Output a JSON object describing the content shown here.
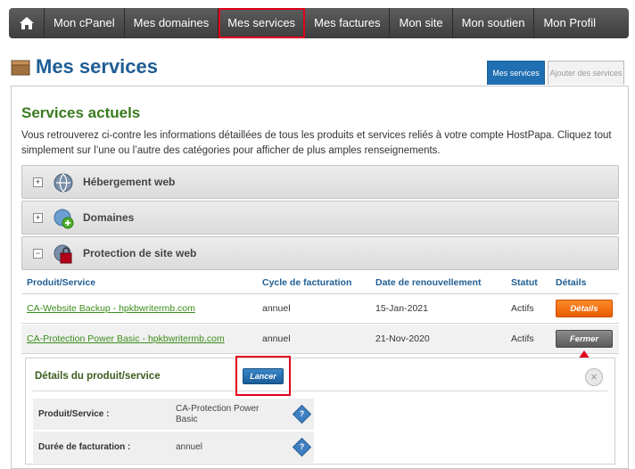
{
  "nav": {
    "items": [
      {
        "label": "Mon cPanel"
      },
      {
        "label": "Mes domaines"
      },
      {
        "label": "Mes services"
      },
      {
        "label": "Mes factures"
      },
      {
        "label": "Mon site"
      },
      {
        "label": "Mon soutien"
      },
      {
        "label": "Mon Profil"
      }
    ],
    "active": "Mes services"
  },
  "page": {
    "title": "Mes services",
    "tabs": [
      {
        "label": "Mes services"
      },
      {
        "label": "Ajouter des services"
      }
    ]
  },
  "section": {
    "title": "Services actuels",
    "description": "Vous retrouverez ci-contre les informations détaillées de tous les produits et services reliés à votre compte HostPapa. Cliquez tout simplement sur l’une ou l’autre des catégories pour afficher de plus amples renseignements."
  },
  "categories": [
    {
      "label": "Hébergement web",
      "toggle": "+",
      "icon": "web-hosting-icon"
    },
    {
      "label": "Domaines",
      "toggle": "+",
      "icon": "domains-icon"
    },
    {
      "label": "Protection de site web",
      "toggle": "−",
      "icon": "site-protection-icon"
    }
  ],
  "table": {
    "headers": [
      "Produit/Service",
      "Cycle de facturation",
      "Date de renouvellement",
      "Statut",
      "Détails"
    ],
    "rows": [
      {
        "product": "CA-Website Backup - hpkbwritermb.com",
        "cycle": "annuel",
        "renewal": "15-Jan-2021",
        "status": "Actifs",
        "action": "Détails"
      },
      {
        "product": "CA-Protection Power Basic - hpkbwritermb.com",
        "cycle": "annuel",
        "renewal": "21-Nov-2020",
        "status": "Actifs",
        "action": "Fermer"
      }
    ]
  },
  "details": {
    "title": "Détails du produit/service",
    "launch_label": "Lancer",
    "close_symbol": "×",
    "fields": [
      {
        "key": "Produit/Service :",
        "value": "CA-Protection Power Basic"
      },
      {
        "key": "Durée de facturation :",
        "value": "annuel"
      }
    ]
  },
  "colors": {
    "nav_bg": "#4a4a4a",
    "title_blue": "#1f5d94",
    "green": "#3a7b1f",
    "highlight_red": "#e0001b",
    "orange_button": "#f06a00"
  }
}
